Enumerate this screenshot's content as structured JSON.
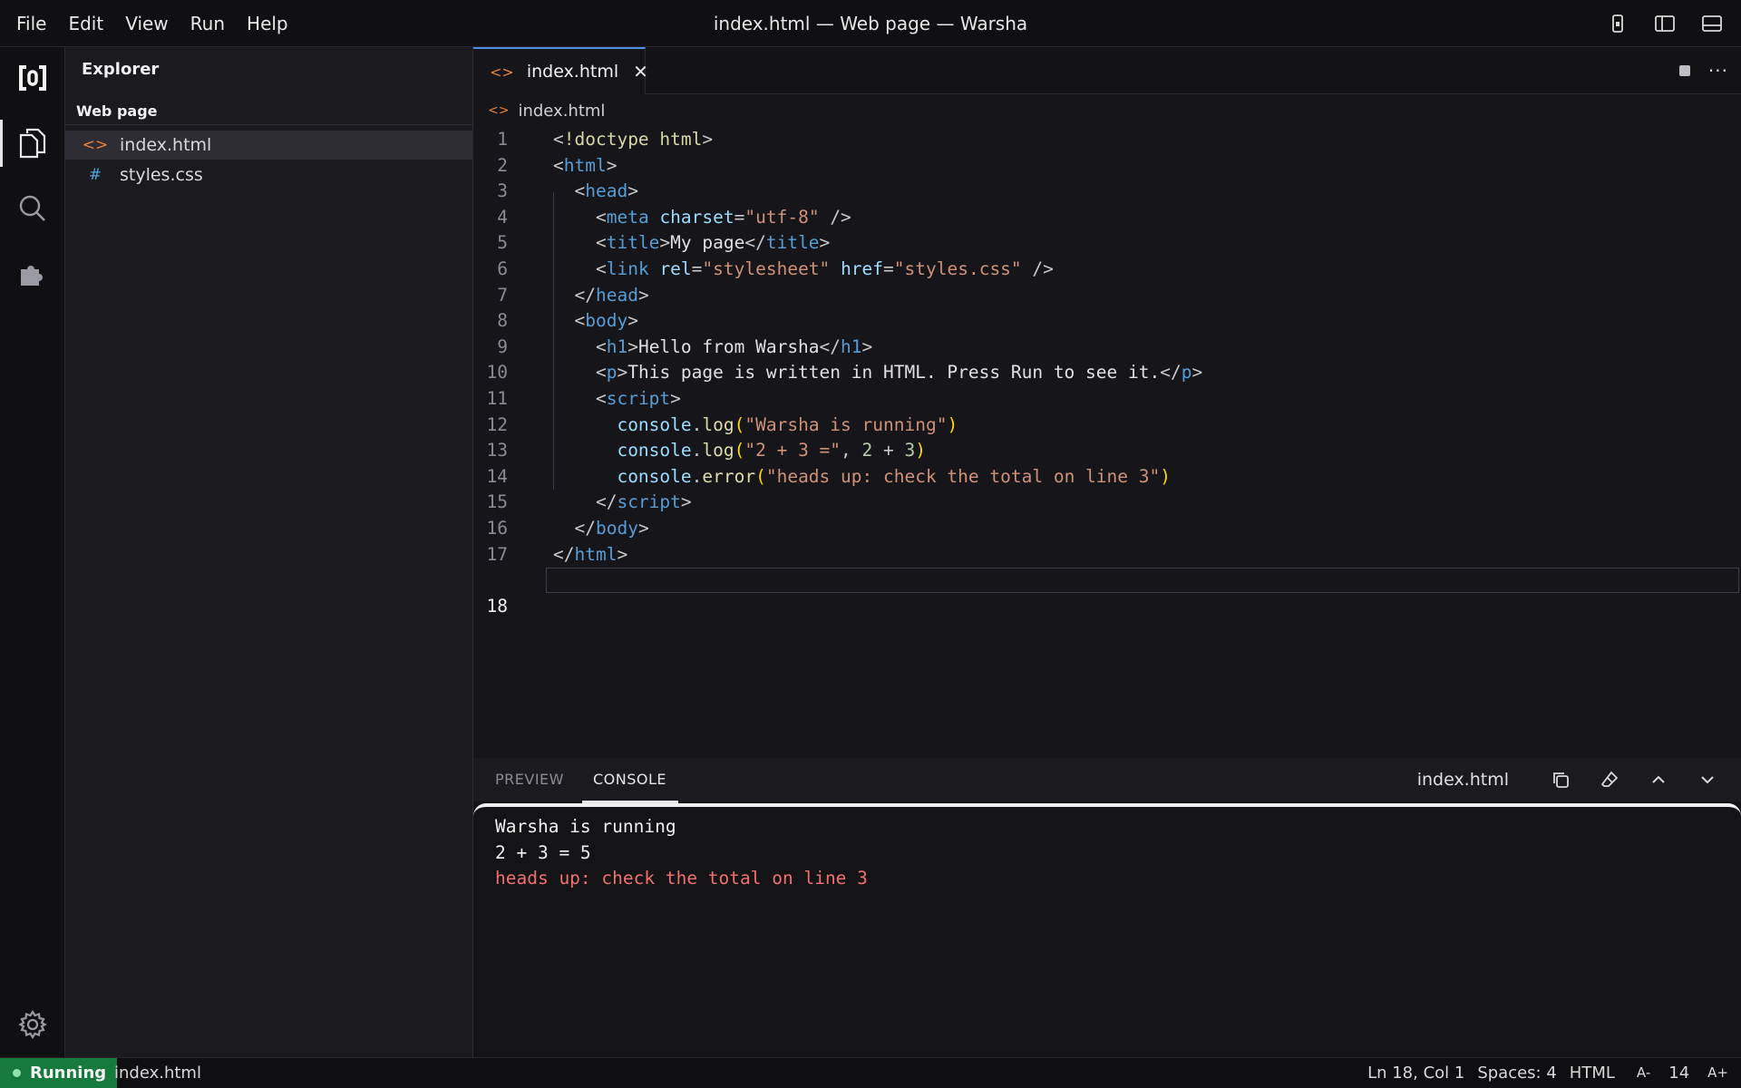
{
  "menu": [
    "File",
    "Edit",
    "View",
    "Run",
    "Help"
  ],
  "window_title": "index.html — Web page — Warsha",
  "activity_bar": {
    "items": [
      {
        "name": "logo-icon"
      },
      {
        "name": "explorer-icon",
        "active": true
      },
      {
        "name": "search-icon"
      },
      {
        "name": "extensions-icon"
      }
    ],
    "bottom": "gear-icon"
  },
  "sidebar": {
    "title": "Explorer",
    "project": "Web page",
    "files": [
      {
        "name": "index.html",
        "icon": "html-file-icon",
        "icon_glyph": "<>",
        "selected": true
      },
      {
        "name": "styles.css",
        "icon": "css-file-icon",
        "icon_glyph": "#",
        "selected": false
      }
    ]
  },
  "editor": {
    "tab_label": "index.html",
    "breadcrumb": "index.html",
    "current_line": 18,
    "line_numbers": [
      "1",
      "2",
      "3",
      "4",
      "5",
      "6",
      "7",
      "8",
      "9",
      "10",
      "11",
      "12",
      "13",
      "14",
      "15",
      "16",
      "17",
      "18"
    ]
  },
  "panel": {
    "tab_preview": "PREVIEW",
    "tab_console": "CONSOLE",
    "file": "index.html",
    "console_lines": [
      {
        "text": "Warsha is running",
        "kind": "log"
      },
      {
        "text": "2 + 3 = 5",
        "kind": "log"
      },
      {
        "text": "heads up: check the total on line 3",
        "kind": "error"
      }
    ]
  },
  "status": {
    "running": "Running",
    "file": "index.html",
    "position": "Ln 18, Col 1",
    "spaces": "Spaces: 4",
    "language": "HTML",
    "font_decrease": "A-",
    "font_size": "14",
    "font_increase": "A+"
  },
  "colors": {
    "accent": "#4d8fe8",
    "running_badge": "#167a3c",
    "console_error": "#f07070",
    "html_icon": "#e8833a",
    "css_icon": "#4fa6e0"
  }
}
